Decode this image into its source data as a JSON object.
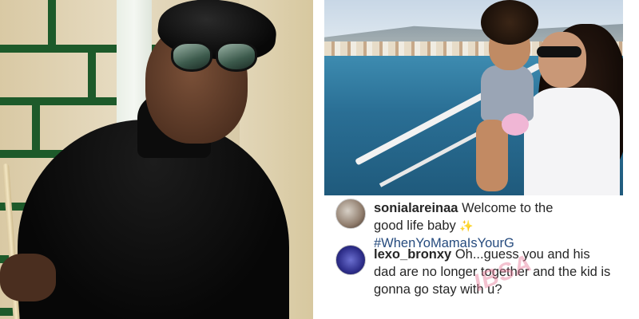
{
  "left_image": {
    "alt_semantic": "man-in-beret-photo"
  },
  "post": {
    "image_semantic": "mother-and-child-boat-photo",
    "comments": [
      {
        "username": "sonialareinaa",
        "text_line1": "Welcome to the",
        "text_line2": "good life baby",
        "emoji": "sparkle",
        "hashtag": "#WhenYoMamaIsYourG"
      },
      {
        "username": "lexo_bronxy",
        "text": "Oh...guess you and his dad are no longer together and the kid is gonna go stay with u?"
      }
    ]
  },
  "watermark": "IBSA",
  "colors": {
    "hashtag": "#264b7e",
    "brick_mortar": "#1d5a2a",
    "sea": "#2a6f95"
  }
}
